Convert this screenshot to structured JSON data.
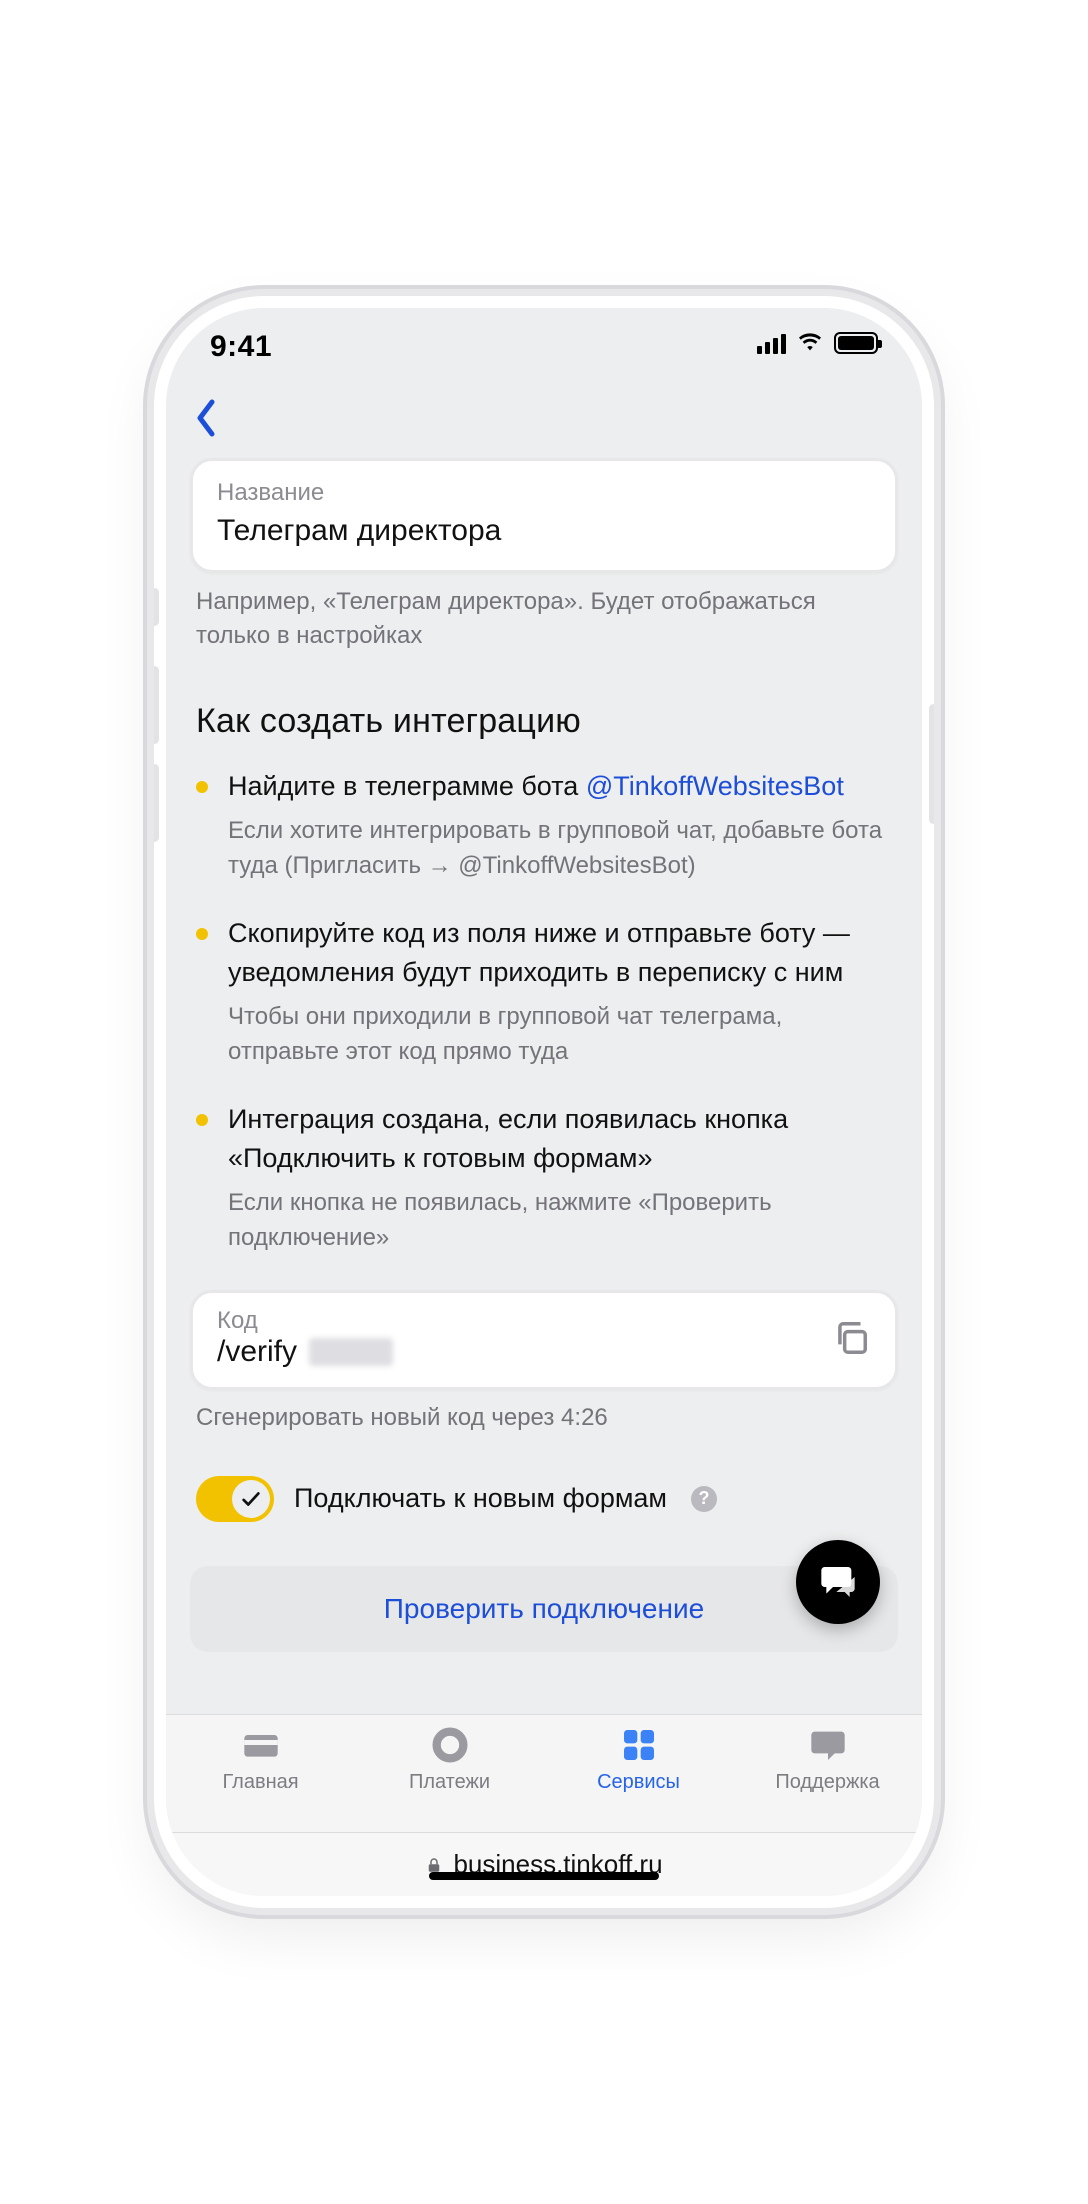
{
  "status": {
    "time": "9:41"
  },
  "field": {
    "label": "Название",
    "value": "Телеграм директора",
    "hint": "Например, «Телеграм директора». Будет отображаться только в настройках"
  },
  "section_title": "Как создать интеграцию",
  "steps": [
    {
      "title_lead": "Найдите в телеграмме бота ",
      "title_link": "@TinkoffWebsitesBot",
      "sub": "Если хотите интегрировать в групповой чат, добавьте бота туда (Пригласить → @TinkoffWebsitesBot)"
    },
    {
      "title": "Скопируйте код из поля ниже и отправьте боту — уведомления будут приходить в переписку с ним",
      "sub": "Чтобы они приходили в групповой чат телеграма, отправьте этот код прямо туда"
    },
    {
      "title": "Интеграция создана, если появилась кнопка «Подключить к готовым формам»",
      "sub": "Если кнопка не появилась, нажмите «Проверить подключение»"
    }
  ],
  "code": {
    "label": "Код",
    "value": "/verify",
    "timer_hint": "Сгенерировать новый код через 4:26"
  },
  "toggle": {
    "label": "Подключать к новым формам",
    "on": true
  },
  "primary_button": "Проверить подключение",
  "tabs": [
    {
      "label": "Главная"
    },
    {
      "label": "Платежи"
    },
    {
      "label": "Сервисы",
      "active": true
    },
    {
      "label": "Поддержка"
    }
  ],
  "url": "business.tinkoff.ru"
}
